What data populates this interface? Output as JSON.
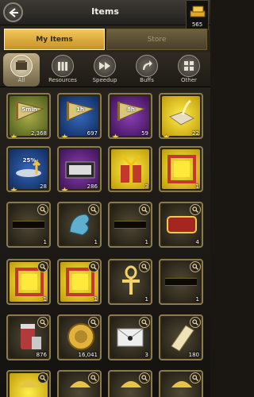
{
  "header": {
    "title": "Items",
    "back_icon": "back-arrow-icon",
    "gold_icon": "gold-bars-icon",
    "gold_amount": "565"
  },
  "tabs": [
    {
      "label": "My Items",
      "active": true
    },
    {
      "label": "Store",
      "active": false
    }
  ],
  "categories": [
    {
      "label": "All",
      "icon": "grid-icon",
      "active": true
    },
    {
      "label": "Resources",
      "icon": "resources-icon",
      "active": false
    },
    {
      "label": "Speedup",
      "icon": "fast-forward-icon",
      "active": false
    },
    {
      "label": "Buffs",
      "icon": "arrow-up-icon",
      "active": false
    },
    {
      "label": "Other",
      "icon": "tiles-icon",
      "active": false
    }
  ],
  "items": [
    {
      "name": "speedup-5min",
      "label": "5min",
      "count": "2,368",
      "bg": "green",
      "star": true
    },
    {
      "name": "speedup-1h",
      "label": "1h",
      "count": "697",
      "bg": "blue",
      "star": true
    },
    {
      "name": "speedup-8h",
      "label": "8h",
      "count": "59",
      "bg": "purple",
      "star": true
    },
    {
      "name": "teleport-map",
      "label": "",
      "count": "22",
      "bg": "gold",
      "star": true
    },
    {
      "name": "gather-boost",
      "label": "25%",
      "count": "28",
      "bg": "blue",
      "star": true
    },
    {
      "name": "briefcase",
      "label": "",
      "count": "286",
      "bg": "purple",
      "star": true
    },
    {
      "name": "gift-box",
      "label": "",
      "count": "3",
      "bg": "gold",
      "star": false
    },
    {
      "name": "frame-red",
      "label": "",
      "count": "1",
      "bg": "gold",
      "star": false
    },
    {
      "name": "nameplate-black",
      "label": "",
      "count": "1",
      "bg": "dark",
      "star": false
    },
    {
      "name": "wave-crest",
      "label": "",
      "count": "1",
      "bg": "dark",
      "star": false
    },
    {
      "name": "nameplate-dark",
      "label": "",
      "count": "1",
      "bg": "dark",
      "star": false
    },
    {
      "name": "tablet-red",
      "label": "",
      "count": "4",
      "bg": "dark",
      "star": false
    },
    {
      "name": "frame-roses",
      "label": "",
      "count": "1",
      "bg": "gold",
      "star": false
    },
    {
      "name": "frame-vines",
      "label": "",
      "count": "1",
      "bg": "gold",
      "star": false
    },
    {
      "name": "ankh-crest",
      "label": "",
      "count": "1",
      "bg": "dark",
      "star": false
    },
    {
      "name": "nameplate-ornate",
      "label": "",
      "count": "1",
      "bg": "dark",
      "star": false
    },
    {
      "name": "supply-jar",
      "label": "",
      "count": "876",
      "bg": "dark",
      "star": false
    },
    {
      "name": "gold-medal",
      "label": "",
      "count": "16,041",
      "bg": "dark",
      "star": false
    },
    {
      "name": "envelope",
      "label": "",
      "count": "3",
      "bg": "dark",
      "star": false
    },
    {
      "name": "scroll",
      "label": "",
      "count": "180",
      "bg": "dark",
      "star": false
    },
    {
      "name": "partial-a",
      "label": "",
      "count": "",
      "bg": "gold",
      "star": false
    },
    {
      "name": "partial-b",
      "label": "",
      "count": "",
      "bg": "dark",
      "star": false
    },
    {
      "name": "partial-c",
      "label": "",
      "count": "",
      "bg": "dark",
      "star": false
    },
    {
      "name": "partial-d",
      "label": "",
      "count": "",
      "bg": "dark",
      "star": false
    }
  ]
}
